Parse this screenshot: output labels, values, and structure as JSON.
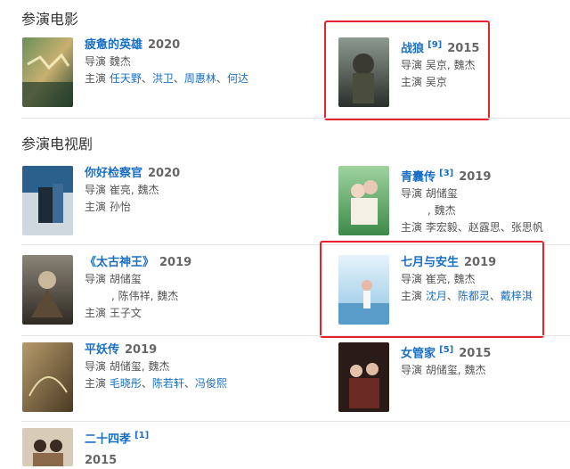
{
  "sections": {
    "films": "参演电影",
    "tv": "参演电视剧"
  },
  "labels": {
    "director": "导演",
    "cast": "主演"
  },
  "films": [
    {
      "title": "疲惫的英雄",
      "year": "2020",
      "cite": "",
      "director": "魏杰",
      "cast": [
        "任天野",
        "洪卫",
        "周惠林",
        "何达"
      ]
    },
    {
      "title": "战狼",
      "year": "2015",
      "cite": "[9]",
      "director": "吴京, 魏杰",
      "cast": [
        "吴京"
      ]
    }
  ],
  "tv": [
    {
      "title": "你好检察官",
      "year": "2020",
      "cite": "",
      "director": "崔亮, 魏杰",
      "cast": [
        "孙怡"
      ]
    },
    {
      "title": "青囊传",
      "year": "2019",
      "cite": "[3]",
      "director": "胡储玺",
      "director2": ", 魏杰",
      "cast": [
        "李宏毅",
        "赵露思",
        "张思帆"
      ]
    },
    {
      "title": "《太古神王》",
      "year": "2019",
      "cite": "",
      "director": "胡储玺",
      "director2": ", 陈伟祥, 魏杰",
      "cast": [
        "王子文"
      ]
    },
    {
      "title": "七月与安生",
      "year": "2019",
      "cite": "",
      "director": "崔亮, 魏杰",
      "cast": [
        "沈月",
        "陈都灵",
        "戴梓淇"
      ]
    },
    {
      "title": "平妖传",
      "year": "2019",
      "cite": "",
      "director": "胡储玺, 魏杰",
      "cast": [
        "毛晓彤",
        "陈若轩",
        "冯俊熙"
      ]
    },
    {
      "title": "女管家",
      "year": "2015",
      "cite": "[5]",
      "director": "胡储玺, 魏杰",
      "cast": []
    },
    {
      "title": "二十四孝",
      "year": "2015",
      "cite": "[1]",
      "director": "",
      "cast": []
    }
  ],
  "colors": {
    "link": "#1a6fc4",
    "highlight": "#e8222a",
    "divider": "#e5e5e5"
  }
}
